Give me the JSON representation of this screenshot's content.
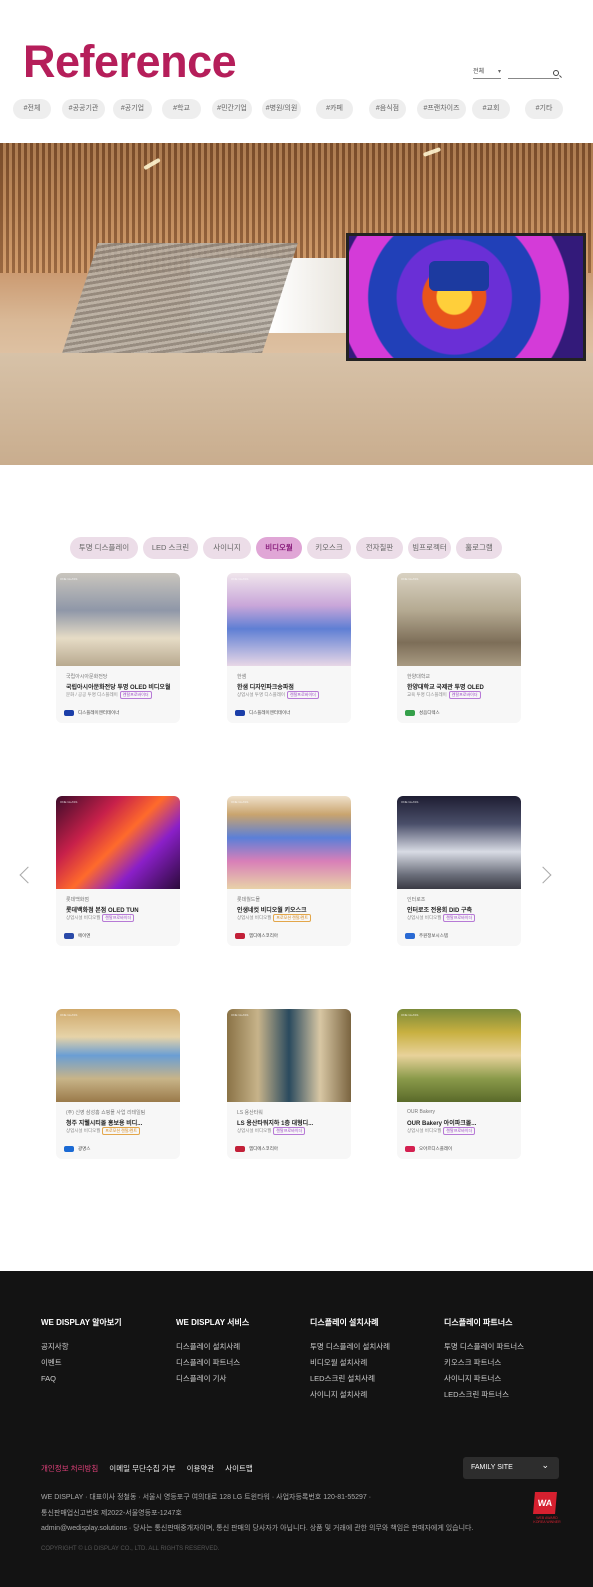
{
  "header": {
    "title": "Reference",
    "filter_select": "전체",
    "search_placeholder": ""
  },
  "tags": [
    "#전체",
    "#공공기관",
    "#공기업",
    "#학교",
    "#민간기업",
    "#병원/의원",
    "#카페",
    "#음식점",
    "#프랜차이즈",
    "#교회",
    "#기타"
  ],
  "categories": [
    {
      "label": "투명 디스플레이",
      "active": false
    },
    {
      "label": "LED 스크린",
      "active": false
    },
    {
      "label": "사이니지",
      "active": false
    },
    {
      "label": "비디오월",
      "active": true
    },
    {
      "label": "키오스크",
      "active": false
    },
    {
      "label": "전자칠판",
      "active": false
    },
    {
      "label": "빔프로젝터",
      "active": false
    },
    {
      "label": "홀로그램",
      "active": false
    }
  ],
  "cards": [
    {
      "org": "국립아시아문화전당",
      "name": "국립아시아문화전당 투명 OLED 비디오월",
      "sub": "문화 / 공공 투명 디스플레이",
      "badge": "렌탈프로바이더",
      "badge_style": "purple",
      "partner": "디스플레이엔터테이너",
      "partner_color": "#1b3ea8",
      "img": "linear-gradient(180deg,#c9c5bd,#8f97a8 40%,#e6dcc6 70%,#b8a98f)"
    },
    {
      "org": "한샘",
      "name": "한샘 디자인파크송파점",
      "sub": "상업시설 투명 디스플레이",
      "badge": "렌탈프로바이더",
      "badge_style": "purple",
      "partner": "디스플레이엔터테이너",
      "partner_color": "#1b3ea8",
      "img": "linear-gradient(180deg,#f0e6ec,#c9a6d9 35%,#5f7fd4 60%,#e8d7e6)"
    },
    {
      "org": "한양대학교",
      "name": "한양대학교 국제관 투명 OLED",
      "sub": "교육 투명 디스플레이",
      "badge": "렌탈프로바이더",
      "badge_style": "purple",
      "partner": "성음디렉스",
      "partner_color": "#35a04a",
      "img": "linear-gradient(180deg,#d9d2c2,#b5aa92 40%,#7d6e58 75%,#a89a82)"
    },
    {
      "org": "롯데백화점",
      "name": "롯데백화점 본점 OLED TUN",
      "sub": "상업시설 비디오월",
      "badge": "렌탈프로바이더",
      "badge_style": "purple",
      "partner": "에이엔",
      "partner_color": "#2a4aa8",
      "img": "linear-gradient(135deg,#3d0c2a,#c7204a 30%,#ff6a2b 50%,#8a1fc8 70%,#2b0a3a)"
    },
    {
      "org": "롯데월드몰",
      "name": "인생네컷 비디오월 키오스크",
      "sub": "상업시설 비디오월",
      "badge": "프로모션 렌탈/렌트",
      "badge_style": "gold",
      "partner": "엠디에스코리아",
      "partner_color": "#c22038",
      "img": "linear-gradient(180deg,#efe1cc,#c9a46e 20%,#5b7fd8 45%,#d87fb8 70%,#e8d2a8)"
    },
    {
      "org": "인터로조",
      "name": "인터로조 전용회 DID 구축",
      "sub": "상업시설 비디오월",
      "badge": "렌탈프로바이더",
      "badge_style": "purple",
      "partner": "주원정보시스템",
      "partner_color": "#2a6ad4",
      "img": "linear-gradient(180deg,#1e1d32,#4a4f6a 30%,#d8dbe4 60%,#6a6e7a 85%,#3a3a44)"
    },
    {
      "org": "(주) 신영 삼성홈 쇼핑몰 사업 리테일팀",
      "name": "청주 지웰시티몰 홍보용 비디...",
      "sub": "상업시설 비디오월",
      "badge": "프로모션 렌탈/렌트",
      "badge_style": "gold",
      "partner": "광명스",
      "partner_color": "#1b6ad4",
      "img": "linear-gradient(180deg,#cfa86a,#e6d3a8 30%,#6a9ed4 50%,#c8b488 75%,#9a7a4a)"
    },
    {
      "org": "LS 용산타워",
      "name": "LS 용산타워지하 1층 대형디...",
      "sub": "상업시설 비디오월",
      "badge": "렌탈프로바이더",
      "badge_style": "purple",
      "partner": "엠디에스코리아",
      "partner_color": "#c22038",
      "img": "linear-gradient(90deg,#8a7346,#c7b38a 25%,#2a4a5e 50%,#d8c7a4 75%,#7a6440)"
    },
    {
      "org": "OUR Bakery",
      "name": "OUR Bakery 아이파크몰...",
      "sub": "상업시설 비디오월",
      "badge": "렌탈프로바이더",
      "badge_style": "purple",
      "partner": "오아르디스플레이",
      "partner_color": "#d42050",
      "img": "linear-gradient(180deg,#7a8a3a,#c8b040 25%,#e8d29a 50%,#8a9a4a 75%,#5a6a2a)"
    }
  ],
  "card_label": "ONE GLASS",
  "footer": {
    "columns": [
      {
        "title": "WE DISPLAY 알아보기",
        "items": [
          "공지사항",
          "이벤트",
          "FAQ"
        ]
      },
      {
        "title": "WE DISPLAY 서비스",
        "items": [
          "디스플레이 설치사례",
          "디스플레이 파트너스",
          "디스플레이 기사"
        ]
      },
      {
        "title": "디스플레이 설치사례",
        "items": [
          "투명 디스플레이 설치사례",
          "비디오월 설치사례",
          "LED스크린 설치사례",
          "사이니지 설치사례"
        ]
      },
      {
        "title": "디스플레이 파트너스",
        "items": [
          "투명 디스플레이 파트너스",
          "키오스크 파트너스",
          "사이니지 파트너스",
          "LED스크린 파트너스"
        ]
      }
    ],
    "links": [
      "개인정보 처리방침",
      "이메일 무단수집 거부",
      "이용약관",
      "사이트맵"
    ],
    "family_site": "FAMILY SITE",
    "info_line1": "WE DISPLAY · 대표이사 정철동 · 서울시 영등포구 여의대로 128 LG 트윈타워 · 사업자등록번호 120-81-55297 ·",
    "info_line2": "통신판매업신고번호 제2022-서울영등포-1247호",
    "info_line3": "admin@wedisplay.solutions · 당사는 통신판매중개자이며, 통신 판매의 당사자가 아닙니다. 상품 및 거래에 관한 의무와 책임은 판매자에게 있습니다.",
    "copyright": "COPYRIGHT © LG DISPLAY CO., LTD. ALL RIGHTS RESERVED.",
    "brand_mark": "WA",
    "brand_sub": "WEB AWARD KOREA WINNER"
  }
}
